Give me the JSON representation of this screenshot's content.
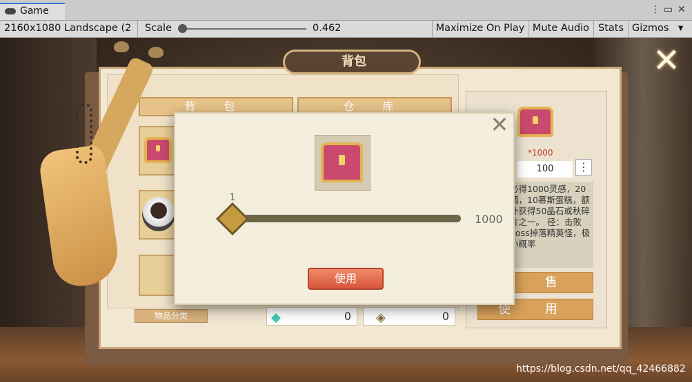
{
  "editor": {
    "tab_title": "Game",
    "resolution": "2160x1080 Landscape (2",
    "scale_label": "Scale",
    "scale_value": "0.462",
    "maximize_on_play": "Maximize On Play",
    "mute_audio": "Mute Audio",
    "stats": "Stats",
    "gizmos": "Gizmos",
    "icons": [
      "gamepad-icon",
      "kebab-menu-icon",
      "maximize-icon",
      "close-icon",
      "dropdown-arrow-icon"
    ]
  },
  "game": {
    "window_title": "背包",
    "tabs": [
      "背 包",
      "仓 库"
    ],
    "category_button": "物品分类",
    "currency": [
      {
        "icon": "diamond-icon",
        "value": "0"
      },
      {
        "icon": "crystal-icon",
        "value": "0"
      }
    ],
    "detail": {
      "reward": "*1000",
      "quantity": "100",
      "menu_icon": "⋮",
      "description": "必得1000灵感，20酒，10慕斯蛋糕，额外获得50晶石或秋碎片之一。\n径：击败boss掉落精英怪，极小概率",
      "sell_button": "出 售",
      "use_button": "使 用"
    },
    "modal": {
      "min_label": "1",
      "max_label": "1000",
      "slider_value": 1,
      "use_button": "使用",
      "close_icon": "close-icon"
    },
    "colors": {
      "accent": "#d7553c",
      "gold": "#c49b40",
      "panel": "#f4eedd"
    }
  },
  "watermark": "https://blog.csdn.net/qq_42466882"
}
